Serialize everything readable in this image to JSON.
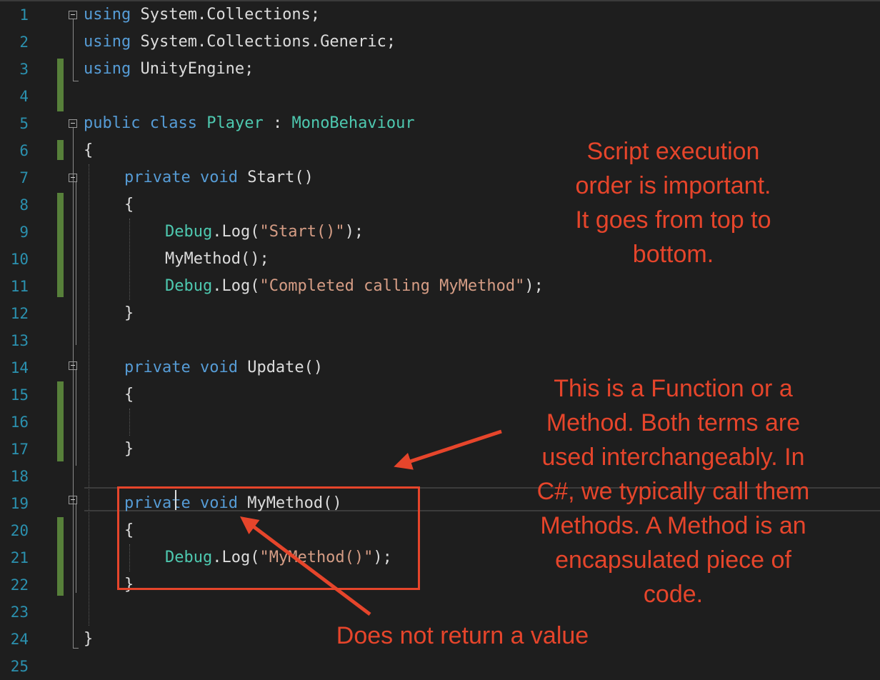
{
  "line_numbers": [
    "1",
    "2",
    "3",
    "4",
    "5",
    "6",
    "7",
    "8",
    "9",
    "10",
    "11",
    "12",
    "13",
    "14",
    "15",
    "16",
    "17",
    "18",
    "19",
    "20",
    "21",
    "22",
    "23",
    "24",
    "25"
  ],
  "code": {
    "l1": [
      "using",
      " System.Collections;"
    ],
    "l2": [
      "using",
      " System.Collections.Generic;"
    ],
    "l3": [
      "using",
      " UnityEngine;"
    ],
    "l5": [
      "public",
      " ",
      "class",
      " ",
      "Player",
      " : ",
      "MonoBehaviour"
    ],
    "l6": "{",
    "l7": [
      "private",
      " ",
      "void",
      " Start()"
    ],
    "l8": "{",
    "l9": [
      "Debug",
      ".Log(",
      "\"Start()\"",
      ");"
    ],
    "l10": "MyMethod();",
    "l11": [
      "Debug",
      ".Log(",
      "\"Completed calling MyMethod\"",
      ");"
    ],
    "l12": "}",
    "l14": [
      "private",
      " ",
      "void",
      " Update()"
    ],
    "l15": "{",
    "l17": "}",
    "l19": [
      "private",
      " ",
      "void",
      " MyMethod()"
    ],
    "l20": "{",
    "l21": [
      "Debug",
      ".Log(",
      "\"MyMethod()\"",
      ");"
    ],
    "l22": "}",
    "l24": "}"
  },
  "annotations": {
    "execution_order": [
      "Script execution",
      "order is important.",
      "It goes from top to",
      "bottom."
    ],
    "function_method": [
      "This is a Function or a",
      "Method. Both terms are",
      "used interchangeably. In",
      "C#, we typically call them",
      "Methods. A Method is an",
      "encapsulated piece of",
      "code."
    ],
    "no_return": "Does not return a value"
  },
  "colors": {
    "background": "#1e1e1e",
    "keyword": "#569cd6",
    "type": "#4ec9b0",
    "string": "#d69d85",
    "line_number": "#2b91af",
    "change_margin": "#57803a",
    "annotation": "#e6452b"
  },
  "icons": [
    "collapse-icon"
  ]
}
